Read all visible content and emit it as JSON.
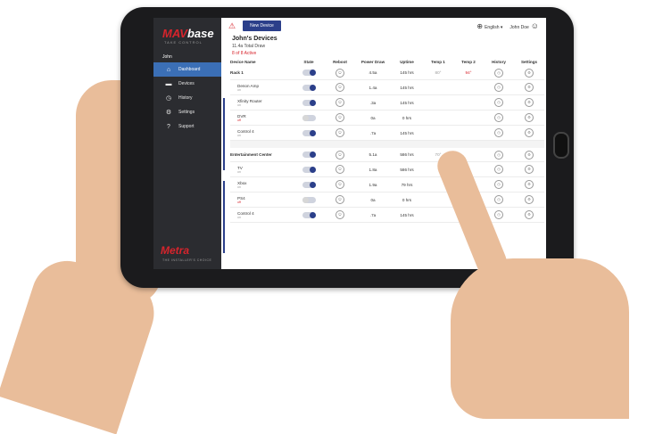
{
  "sidebar": {
    "logo_prefix": "MAV",
    "logo_suffix": "base",
    "tagline": "TAKE CONTROL",
    "user": "John",
    "items": [
      {
        "label": "Dashboard",
        "icon": "home-icon"
      },
      {
        "label": "Devices",
        "icon": "devices-icon"
      },
      {
        "label": "History",
        "icon": "clock-icon"
      },
      {
        "label": "Settings",
        "icon": "gear-icon"
      },
      {
        "label": "Support",
        "icon": "help-icon"
      }
    ],
    "brand": "Metra",
    "brand_tag": "THE INSTALLER'S CHOICE"
  },
  "topbar": {
    "new_device_label": "New Device",
    "language": "English",
    "user": "John Doe"
  },
  "summary": {
    "title": "John's Devices",
    "total_draw": "11.4a Total Draw",
    "active": "8 of 8 Active"
  },
  "table": {
    "headers": [
      "Device Name",
      "State",
      "Reboot",
      "Power Draw",
      "Uptime",
      "Temp 1",
      "Temp 2",
      "History",
      "Settings"
    ],
    "groups": [
      {
        "name": "Rack 1",
        "power": "4.5a",
        "uptime": "145 hrs",
        "temp1": "80°",
        "temp2": "94°",
        "devices": [
          {
            "name": "Denon Amp",
            "status": "on",
            "power": "1.4a",
            "uptime": "145 hrs"
          },
          {
            "name": "Xfinity Router",
            "status": "on",
            "power": ".3a",
            "uptime": "145 hrs"
          },
          {
            "name": "DVR",
            "status": "off",
            "power": "0a",
            "uptime": "0 hrs"
          },
          {
            "name": "Control 4",
            "status": "on",
            "power": ".7a",
            "uptime": "145 hrs"
          }
        ]
      },
      {
        "name": "Entertainment Center",
        "power": "5.1a",
        "uptime": "586 hrs",
        "temp1": "70°",
        "temp2": "",
        "devices": [
          {
            "name": "TV",
            "status": "on",
            "power": "1.8a",
            "uptime": "586 hrs"
          },
          {
            "name": "Xbox",
            "status": "on",
            "power": "1.9a",
            "uptime": "79 hrs"
          },
          {
            "name": "PS4",
            "status": "off",
            "power": "0a",
            "uptime": "0 hrs"
          },
          {
            "name": "Control 4",
            "status": "on",
            "power": ".7a",
            "uptime": "145 hrs"
          }
        ]
      }
    ]
  },
  "colors": {
    "accent": "#2b3f8a",
    "brand_red": "#d7242c",
    "sidebar": "#2b2c30",
    "active_nav": "#3b6fb6"
  }
}
